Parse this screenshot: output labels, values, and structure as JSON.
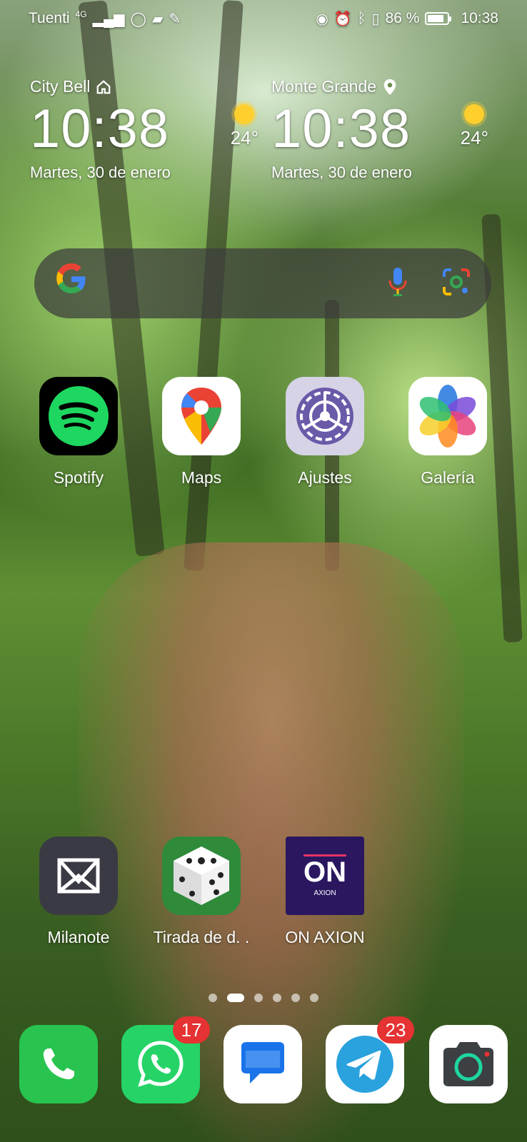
{
  "status_bar": {
    "carrier": "Tuenti",
    "network": "4G",
    "battery_percent": "86 %",
    "battery_level": 0.86,
    "time": "10:38",
    "icons": [
      "signal-icon",
      "whatsapp-icon",
      "chat-icon",
      "wrench-icon",
      "eye-icon",
      "alarm-icon",
      "bluetooth-icon",
      "vibrate-icon",
      "battery-icon"
    ]
  },
  "clocks": [
    {
      "city": "City Bell",
      "city_icon": "home-icon",
      "time": "10:38",
      "date": "Martes, 30 de enero",
      "temp": "24°",
      "weather_icon": "sun-icon"
    },
    {
      "city": "Monte Grande",
      "city_icon": "location-pin-icon",
      "time": "10:38",
      "date": "Martes, 30 de enero",
      "temp": "24°",
      "weather_icon": "sun-icon"
    }
  ],
  "search": {
    "logo": "G",
    "mic_icon": "mic-icon",
    "lens_icon": "google-lens-icon"
  },
  "apps_top": [
    {
      "label": "Spotify",
      "icon": "spotify-icon"
    },
    {
      "label": "Maps",
      "icon": "maps-icon"
    },
    {
      "label": "Ajustes",
      "icon": "settings-icon"
    },
    {
      "label": "Galería",
      "icon": "gallery-icon"
    }
  ],
  "apps_bottom": [
    {
      "label": "Milanote",
      "icon": "milanote-icon"
    },
    {
      "label": "Tirada de d. .",
      "icon": "dice-icon"
    },
    {
      "label": "ON AXION",
      "icon": "on-axion-icon",
      "tile_text": "ON",
      "tile_subtext": "AXION"
    }
  ],
  "page_indicator": {
    "pages": 6,
    "active_index": 1
  },
  "dock": [
    {
      "name": "phone",
      "icon": "phone-icon"
    },
    {
      "name": "whatsapp",
      "icon": "whatsapp-icon",
      "badge": "17"
    },
    {
      "name": "messages",
      "icon": "messages-icon"
    },
    {
      "name": "telegram",
      "icon": "telegram-icon",
      "badge": "23"
    },
    {
      "name": "camera",
      "icon": "camera-icon"
    }
  ],
  "colors": {
    "whatsapp": "#25d366",
    "telegram": "#2aa2de",
    "badge": "#e53232",
    "spotify": "#1ed760"
  }
}
